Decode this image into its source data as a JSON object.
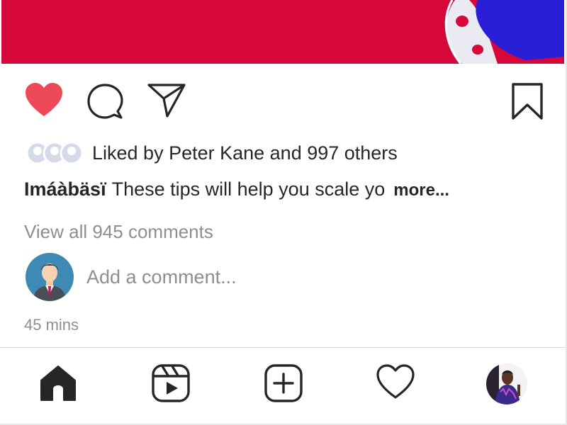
{
  "post": {
    "liked_by_text": "Liked by Peter Kane and 997 others",
    "caption": {
      "username": "Imáàbäsï",
      "text": "These tips will help you scale yo",
      "more_label": "more..."
    },
    "view_comments_label": "View all 945 comments",
    "add_comment_placeholder": "Add a comment...",
    "timestamp": "45 mins"
  },
  "actions": {
    "like": "heart-filled-icon",
    "comment": "comment-bubble-icon",
    "share": "paper-plane-icon",
    "save": "bookmark-icon"
  },
  "bottom_nav": [
    {
      "icon": "home-icon"
    },
    {
      "icon": "reels-icon"
    },
    {
      "icon": "create-post-icon"
    },
    {
      "icon": "activity-heart-icon"
    },
    {
      "icon": "profile-avatar"
    }
  ],
  "colors": {
    "image_red": "#d6083a",
    "image_blue": "#2a1fd6",
    "like_red": "#ee4956",
    "text": "#262626",
    "muted": "#8e8e8e"
  }
}
